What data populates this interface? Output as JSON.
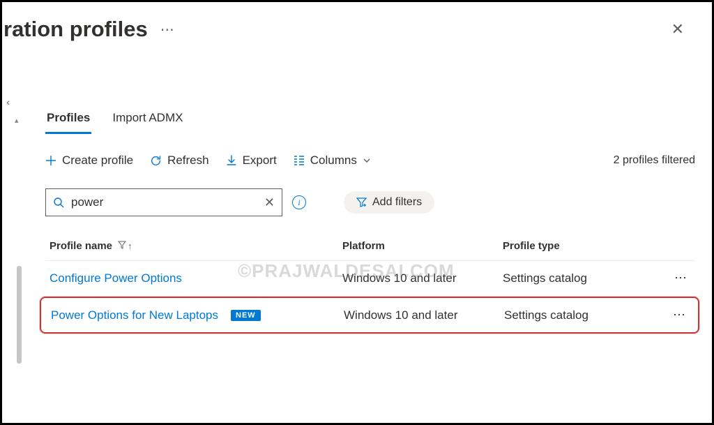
{
  "header": {
    "title_fragment": "ration profiles"
  },
  "tabs": {
    "profiles": "Profiles",
    "import_admx": "Import ADMX"
  },
  "toolbar": {
    "create": "Create profile",
    "refresh": "Refresh",
    "export": "Export",
    "columns": "Columns",
    "filter_count": "2 profiles filtered"
  },
  "search": {
    "value": "power",
    "add_filters": "Add filters"
  },
  "table": {
    "headers": {
      "name": "Profile name",
      "platform": "Platform",
      "type": "Profile type"
    },
    "rows": [
      {
        "name": "Configure Power Options",
        "is_new": false,
        "platform": "Windows 10 and later",
        "type": "Settings catalog"
      },
      {
        "name": "Power Options for New Laptops",
        "is_new": true,
        "new_label": "NEW",
        "platform": "Windows 10 and later",
        "type": "Settings catalog"
      }
    ]
  },
  "watermark": "©PRAJWALDESAI.COM"
}
